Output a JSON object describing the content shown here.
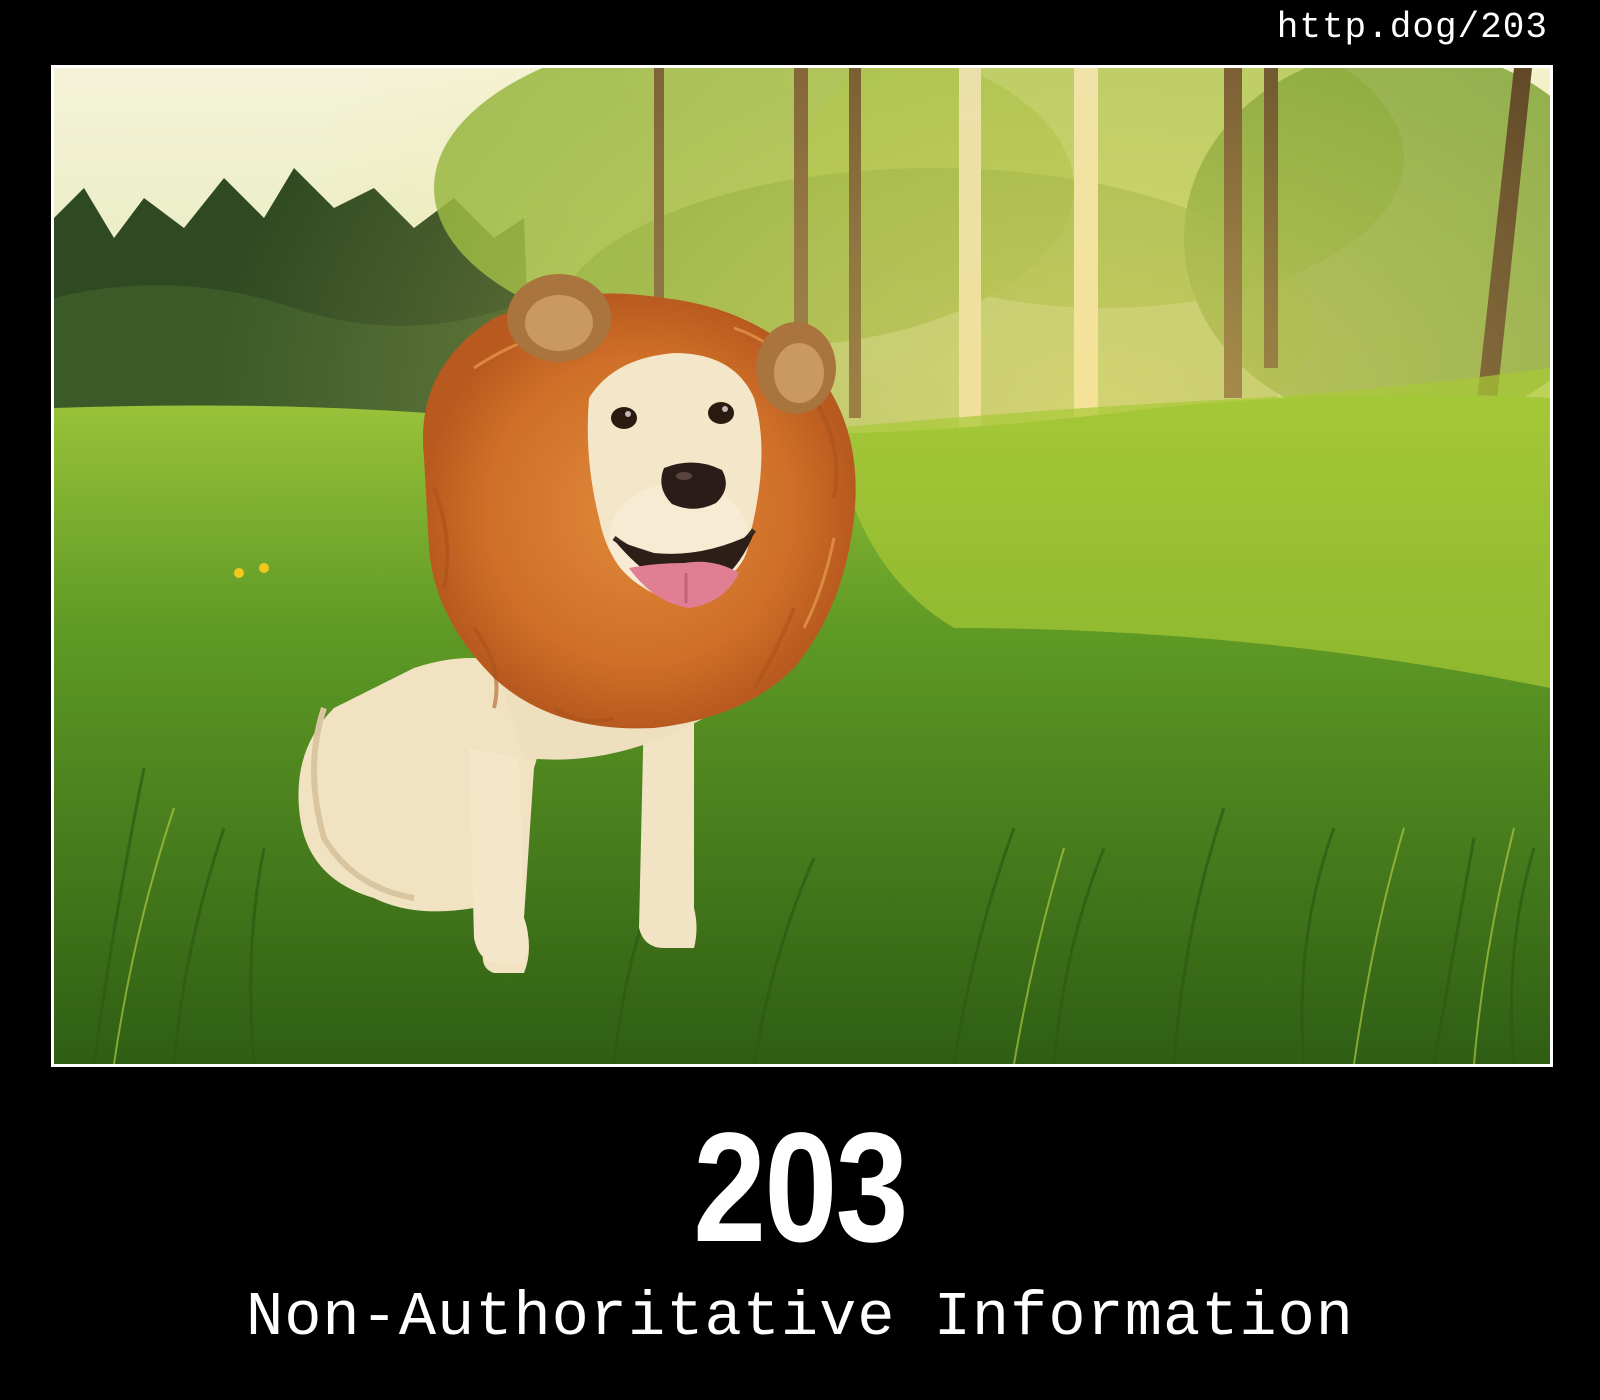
{
  "header": {
    "url": "http.dog/203"
  },
  "photo": {
    "subject": "dog-in-lion-mane-costume",
    "frame_color": "#ffffff"
  },
  "status": {
    "code": "203",
    "message": "Non-Authoritative Information"
  },
  "colors": {
    "background": "#000000",
    "text": "#ffffff"
  }
}
